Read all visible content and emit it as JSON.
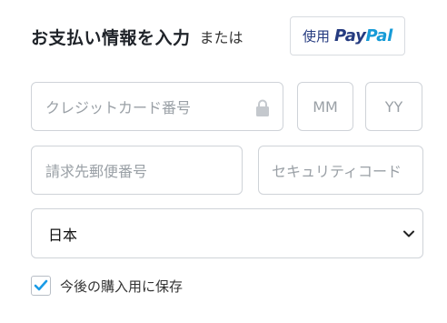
{
  "header": {
    "title": "お支払い情報を入力",
    "or_text": "または",
    "paypal": {
      "use_label": "使用",
      "logo_part1": "Pay",
      "logo_part2": "Pal"
    }
  },
  "fields": {
    "card_number": {
      "placeholder": "クレジットカード番号",
      "icon": "lock-icon"
    },
    "exp_month": {
      "placeholder": "MM"
    },
    "exp_year": {
      "placeholder": "YY"
    },
    "postal_code": {
      "placeholder": "請求先郵便番号"
    },
    "security_code": {
      "placeholder": "セキュリティコード"
    }
  },
  "country": {
    "selected": "日本",
    "icon": "chevron-down-icon"
  },
  "save_option": {
    "label": "今後の購入用に保存",
    "checked": true
  },
  "colors": {
    "paypal_dark": "#253b80",
    "paypal_light": "#179bd7",
    "checkbox_accent": "#1a9be6",
    "placeholder": "#9aa0a6",
    "border": "#cfd3d8"
  }
}
